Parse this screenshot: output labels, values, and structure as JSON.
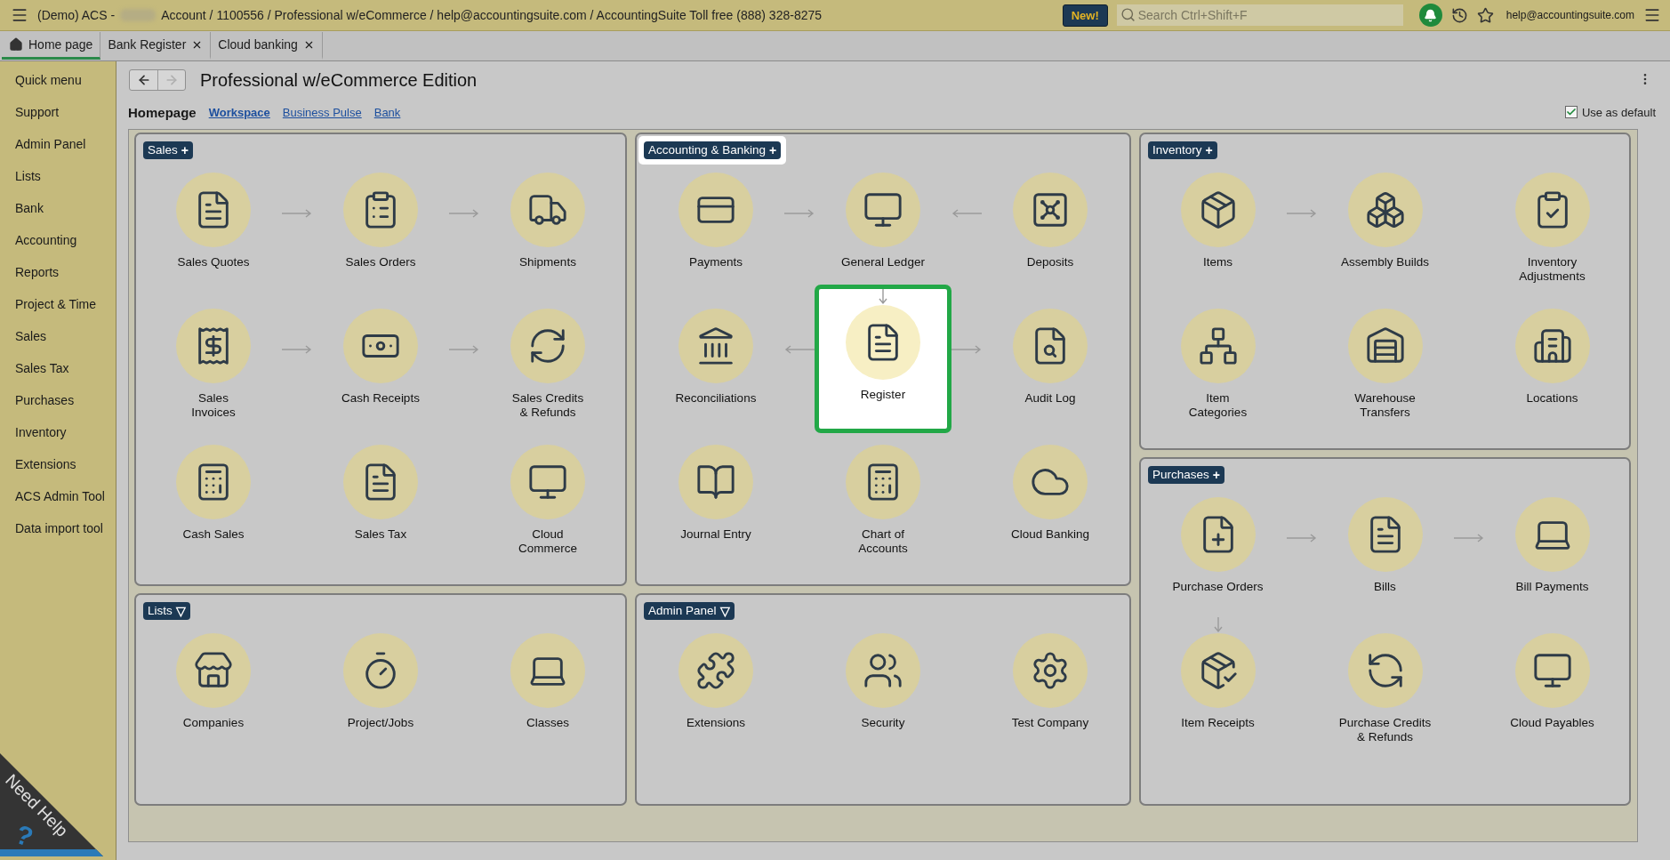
{
  "top_bar": {
    "title_start": "(Demo) ACS -",
    "title_end": "Account / 1100556 / Professional w/eCommerce / help@accountingsuite.com / AccountingSuite Toll free (888) 328-8275",
    "new_button": "New!",
    "search": {
      "placeholder": "Search Ctrl+Shift+F"
    },
    "user_email": "help@accountingsuite.com"
  },
  "tabs": [
    {
      "label": "Home page",
      "selected": true,
      "closable": false
    },
    {
      "label": "Bank Register",
      "selected": false,
      "closable": true
    },
    {
      "label": "Cloud banking",
      "selected": false,
      "closable": true
    }
  ],
  "sidebar": {
    "items": [
      "Quick menu",
      "Support",
      "Admin Panel",
      "Lists",
      "Bank",
      "Accounting",
      "Reports",
      "Project & Time",
      "Sales",
      "Sales Tax",
      "Purchases",
      "Inventory",
      "Extensions",
      "ACS Admin Tool",
      "Data import tool"
    ]
  },
  "need_help": {
    "label": "Need Help",
    "mark": "?"
  },
  "header": {
    "nav_buttons": [
      {
        "disabled": false
      },
      {
        "disabled": true
      }
    ],
    "title": "Professional w/eCommerce Edition",
    "page_label": "Homepage",
    "links": [
      {
        "label": "Workspace",
        "selected": true
      },
      {
        "label": "Business Pulse",
        "selected": false
      },
      {
        "label": "Bank",
        "selected": false
      }
    ],
    "use_as_default": {
      "label": "Use as default",
      "checked": true
    }
  },
  "columns": [
    [
      {
        "title": "Sales",
        "toggle": "+",
        "highlighted": false,
        "rows": [
          {
            "gaps": [
              {
                "arrow": true,
                "reversed": false
              },
              {
                "arrow": true,
                "reversed": false
              }
            ],
            "items": [
              {
                "label": "Sales Quotes",
                "arrow_above": false,
                "highlighted": false
              },
              {
                "label": "Sales Orders",
                "arrow_above": false,
                "highlighted": false
              },
              {
                "label": "Shipments",
                "arrow_above": false,
                "highlighted": false
              }
            ]
          },
          {
            "gaps": [
              {
                "arrow": true,
                "reversed": false
              },
              {
                "arrow": true,
                "reversed": false
              }
            ],
            "items": [
              {
                "label": "Sales\nInvoices",
                "arrow_above": false,
                "highlighted": false
              },
              {
                "label": "Cash Receipts",
                "arrow_above": false,
                "highlighted": false
              },
              {
                "label": "Sales Credits\n& Refunds",
                "arrow_above": false,
                "highlighted": false
              }
            ]
          },
          {
            "gaps": [
              {
                "arrow": false
              },
              {
                "arrow": false
              }
            ],
            "items": [
              {
                "label": "Cash Sales",
                "arrow_above": false,
                "highlighted": false
              },
              {
                "label": "Sales Tax",
                "arrow_above": false,
                "highlighted": false
              },
              {
                "label": "Cloud\nCommerce",
                "arrow_above": false,
                "highlighted": false
              }
            ]
          }
        ]
      },
      {
        "title": "Lists",
        "toggle": "▽",
        "highlighted": false,
        "rows": [
          {
            "gaps": [
              {
                "arrow": false
              },
              {
                "arrow": false
              }
            ],
            "items": [
              {
                "label": "Companies",
                "arrow_above": false,
                "highlighted": false
              },
              {
                "label": "Project/Jobs",
                "arrow_above": false,
                "highlighted": false
              },
              {
                "label": "Classes",
                "arrow_above": false,
                "highlighted": false
              }
            ]
          }
        ]
      }
    ],
    [
      {
        "title": "Accounting & Banking",
        "toggle": "+",
        "highlighted": true,
        "rows": [
          {
            "gaps": [
              {
                "arrow": true,
                "reversed": false
              },
              {
                "arrow": true,
                "reversed": true
              }
            ],
            "items": [
              {
                "label": "Payments",
                "arrow_above": false,
                "highlighted": false
              },
              {
                "label": "General Ledger",
                "arrow_above": false,
                "highlighted": false
              },
              {
                "label": "Deposits",
                "arrow_above": false,
                "highlighted": false
              }
            ]
          },
          {
            "gaps": [
              {
                "arrow": true,
                "reversed": true
              },
              {
                "arrow": true,
                "reversed": false
              }
            ],
            "items": [
              {
                "label": "Reconciliations",
                "arrow_above": false,
                "highlighted": false
              },
              {
                "label": "Register",
                "arrow_above": true,
                "highlighted": true
              },
              {
                "label": "Audit Log",
                "arrow_above": false,
                "highlighted": false
              }
            ]
          },
          {
            "gaps": [
              {
                "arrow": false
              },
              {
                "arrow": false
              }
            ],
            "items": [
              {
                "label": "Journal Entry",
                "arrow_above": false,
                "highlighted": false
              },
              {
                "label": "Chart of\nAccounts",
                "arrow_above": false,
                "highlighted": false
              },
              {
                "label": "Cloud Banking",
                "arrow_above": false,
                "highlighted": false
              }
            ]
          }
        ]
      },
      {
        "title": "Admin Panel",
        "toggle": "▽",
        "highlighted": false,
        "rows": [
          {
            "gaps": [
              {
                "arrow": false
              },
              {
                "arrow": false
              }
            ],
            "items": [
              {
                "label": "Extensions",
                "arrow_above": false,
                "highlighted": false
              },
              {
                "label": "Security",
                "arrow_above": false,
                "highlighted": false
              },
              {
                "label": "Test Company",
                "arrow_above": false,
                "highlighted": false
              }
            ]
          }
        ]
      }
    ],
    [
      {
        "title": "Inventory",
        "toggle": "+",
        "highlighted": false,
        "rows": [
          {
            "gaps": [
              {
                "arrow": true,
                "reversed": false
              },
              {
                "arrow": false
              }
            ],
            "items": [
              {
                "label": "Items",
                "arrow_above": false,
                "highlighted": false
              },
              {
                "label": "Assembly Builds",
                "arrow_above": false,
                "highlighted": false
              },
              {
                "label": "Inventory\nAdjustments",
                "arrow_above": false,
                "highlighted": false
              }
            ]
          },
          {
            "gaps": [
              {
                "arrow": false
              },
              {
                "arrow": false
              }
            ],
            "items": [
              {
                "label": "Item\nCategories",
                "arrow_above": false,
                "highlighted": false
              },
              {
                "label": "Warehouse\nTransfers",
                "arrow_above": false,
                "highlighted": false
              },
              {
                "label": "Locations",
                "arrow_above": false,
                "highlighted": false
              }
            ]
          }
        ]
      },
      {
        "title": "Purchases",
        "toggle": "+",
        "highlighted": false,
        "rows": [
          {
            "gaps": [
              {
                "arrow": true,
                "reversed": false
              },
              {
                "arrow": true,
                "reversed": false
              }
            ],
            "items": [
              {
                "label": "Purchase Orders",
                "arrow_above": false,
                "highlighted": false
              },
              {
                "label": "Bills",
                "arrow_above": false,
                "highlighted": false
              },
              {
                "label": "Bill Payments",
                "arrow_above": false,
                "highlighted": false
              }
            ]
          },
          {
            "gaps": [
              {
                "arrow": false
              },
              {
                "arrow": false
              }
            ],
            "items": [
              {
                "label": "Item Receipts",
                "arrow_above": true,
                "highlighted": false
              },
              {
                "label": "Purchase Credits\n& Refunds",
                "arrow_above": false,
                "highlighted": false
              },
              {
                "label": "Cloud Payables",
                "arrow_above": false,
                "highlighted": false
              }
            ]
          }
        ]
      }
    ]
  ]
}
